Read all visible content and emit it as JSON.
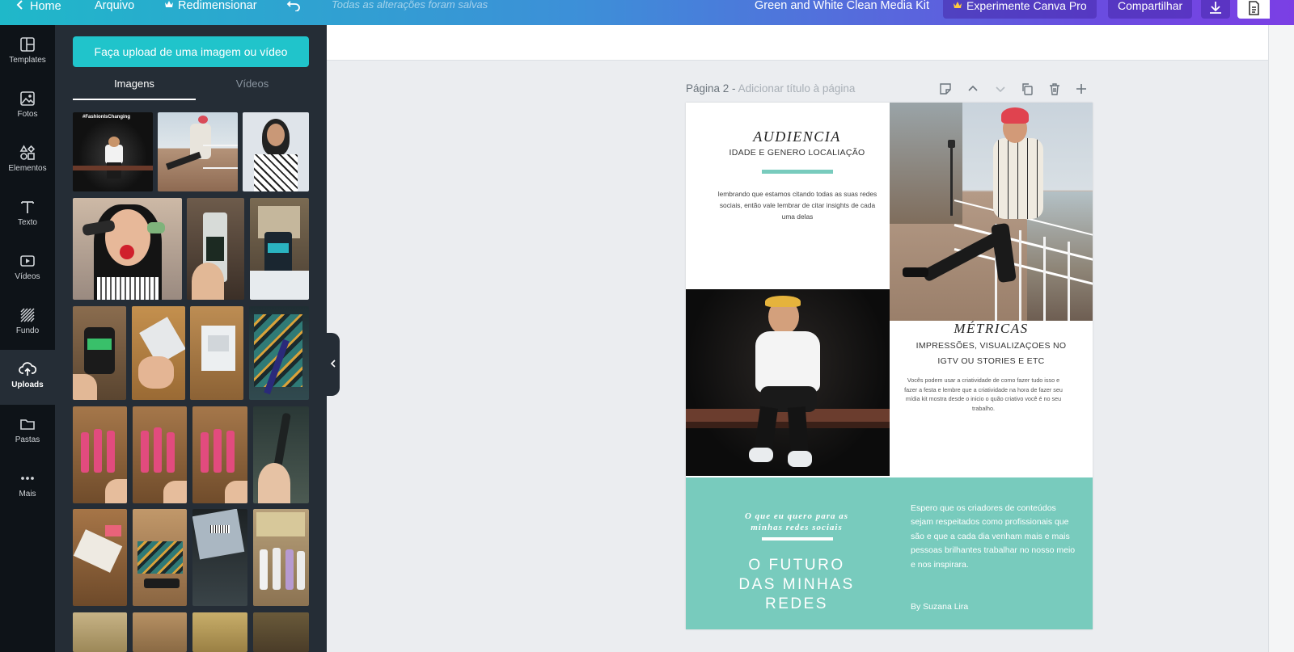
{
  "topbar": {
    "home": "Home",
    "file": "Arquivo",
    "resize": "Redimensionar",
    "saved_status": "Todas as alterações foram salvas",
    "doc_title": "Green and White Clean Media Kit",
    "pro_label": "Experimente Canva Pro",
    "share_label": "Compartilhar"
  },
  "rail": {
    "items": [
      {
        "label": "Templates",
        "icon": "templates-icon"
      },
      {
        "label": "Fotos",
        "icon": "photo-icon"
      },
      {
        "label": "Elementos",
        "icon": "shapes-icon"
      },
      {
        "label": "Texto",
        "icon": "text-icon"
      },
      {
        "label": "Vídeos",
        "icon": "video-icon"
      },
      {
        "label": "Fundo",
        "icon": "background-icon"
      },
      {
        "label": "Uploads",
        "icon": "upload-cloud-icon"
      },
      {
        "label": "Pastas",
        "icon": "folder-icon"
      },
      {
        "label": "Mais",
        "icon": "more-icon"
      }
    ],
    "active": "Uploads"
  },
  "panel": {
    "upload_button": "Faça upload de uma imagem ou vídeo",
    "tabs": [
      "Imagens",
      "Vídeos"
    ],
    "active_tab": "Imagens",
    "first_thumb_caption": "#FashionIsChanging"
  },
  "canvas": {
    "page_label": "Página 2 -",
    "page_title_placeholder": "Adicionar título à página"
  },
  "doc": {
    "audiencia_title": "AUDIENCIA",
    "audiencia_sub": "IDADE E GENERO LOCALIAÇÃO",
    "audiencia_body": "lembrando que estamos citando todas as suas redes sociais, então vale lembrar de citar insights de cada uma delas",
    "metricas_title": "MÉTRICAS",
    "metricas_sub1": "IMPRESSÕES, VISUALIZAÇOES NO",
    "metricas_sub2": "IGTV OU STORIES E ETC",
    "metricas_body": "Vocês podem usar a criatividade de como fazer tudo isso e fazer a festa e lembre que a criatividade na hora de fazer seu mídia kit mostra desde o inicio o quão criativo você é no seu trabalho.",
    "quote_line1": "O que eu quero para as",
    "quote_line2": "minhas redes sociais",
    "future_line1": "O FUTURO",
    "future_line2": "DAS MINHAS",
    "future_line3": "REDES",
    "right_text": "Espero que os criadores de conteúdos sejam respeitados como profissionais que são e que a cada dia venham mais e mais pessoas brilhantes trabalhar no nosso meio e nos inspirara.",
    "signature": "By Suzana Lira"
  },
  "colors": {
    "teal": "#78cbbd",
    "upload_button": "#20c4cb",
    "rail_bg": "#0e1318",
    "panel_bg": "#252d36"
  }
}
